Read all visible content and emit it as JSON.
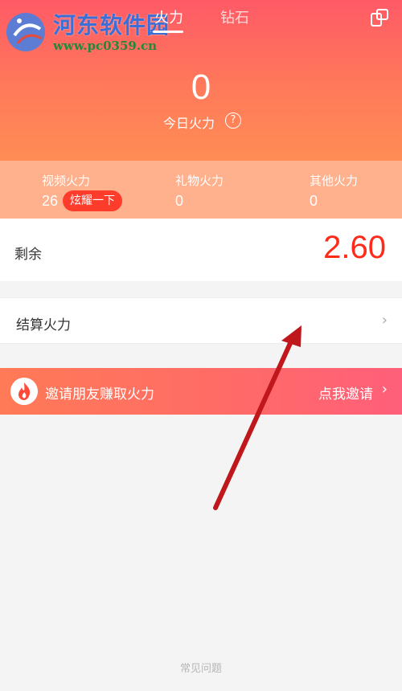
{
  "watermark": {
    "title": "河东软件园",
    "url": "www.pc0359.cn"
  },
  "tabs": [
    {
      "label": "火力",
      "active": true
    },
    {
      "label": "钻石",
      "active": false
    }
  ],
  "header": {
    "today_value": "0",
    "today_label": "今日火力",
    "help_glyph": "?",
    "share_icon": "share-icon"
  },
  "stats": [
    {
      "label": "视频火力",
      "value": "26",
      "badge": "炫耀一下"
    },
    {
      "label": "礼物火力",
      "value": "0"
    },
    {
      "label": "其他火力",
      "value": "0"
    }
  ],
  "remaining": {
    "label": "剩余",
    "value": "2.60"
  },
  "settle": {
    "label": "结算火力",
    "chevron": "›"
  },
  "invite": {
    "text": "邀请朋友赚取火力",
    "cta": "点我邀请",
    "chevron": "›",
    "icon": "flame-icon"
  },
  "footer": {
    "faq": "常见问题"
  },
  "colors": {
    "header_gradient_top": "#fe5a66",
    "header_gradient_bottom": "#ff8d55",
    "stats_bg": "#ffb08d",
    "accent_red": "#ff2a1a",
    "badge_red": "#fe3c2c",
    "annotation_arrow": "#c0171c"
  }
}
